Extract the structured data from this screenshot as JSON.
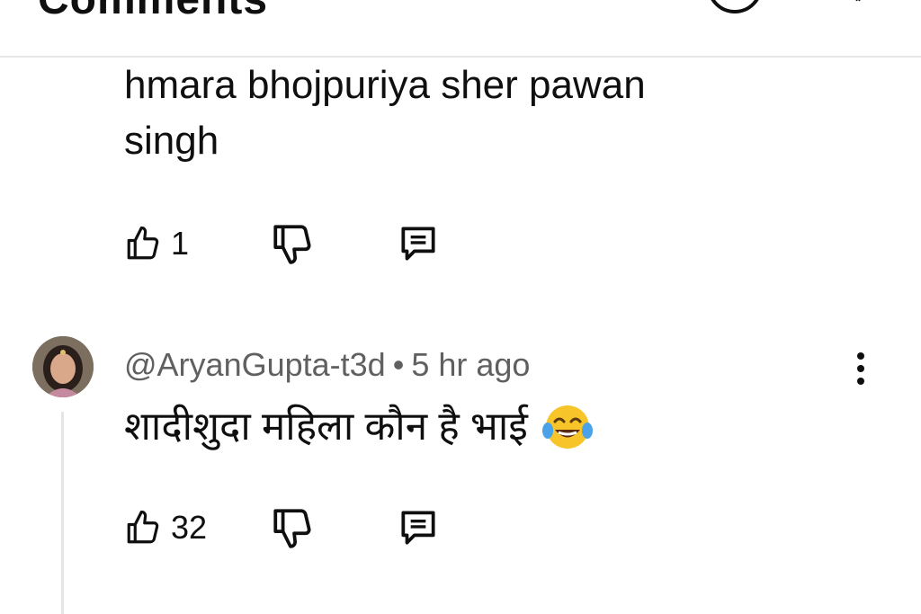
{
  "header": {
    "title": "Comments"
  },
  "comment1": {
    "text_line1": "hmara bhojpuriya sher pawan",
    "text_line2": "singh",
    "likes": "1"
  },
  "comment2": {
    "author": "@AryanGupta-t3d",
    "separator": "•",
    "time": "5 hr ago",
    "text": "शादीशुदा महिला कौन है भाई",
    "emoji": "face-with-tears-of-joy",
    "likes": "32"
  },
  "icons": {
    "like": "thumbs-up-icon",
    "dislike": "thumbs-down-icon",
    "reply": "reply-icon",
    "more": "more-vert-icon",
    "info": "info-icon",
    "close": "close-icon"
  },
  "colors": {
    "text": "#0f0f0f",
    "meta": "#606060",
    "divider": "#e5e5e5",
    "emoji_face": "#f7c52a"
  }
}
